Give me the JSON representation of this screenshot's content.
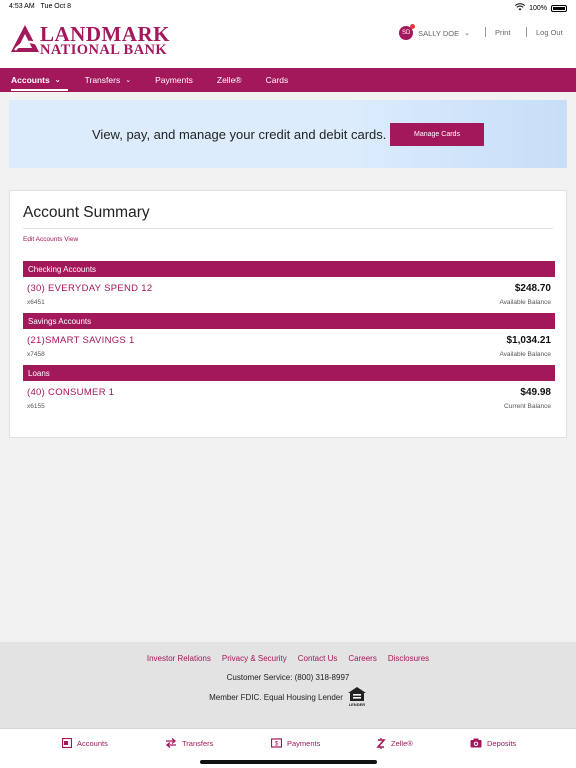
{
  "status_bar": {
    "time": "4:53 AM",
    "date": "Tue Oct 8",
    "battery": "100%"
  },
  "bank": {
    "name_line1": "LANDMARK",
    "name_line2": "NATIONAL BANK",
    "brand_color": "#a3175b"
  },
  "header": {
    "avatar_initials": "SD",
    "user_name": "SALLY DOE",
    "print_label": "Print",
    "logout_label": "Log Out"
  },
  "nav": {
    "items": [
      {
        "label": "Accounts",
        "has_menu": true,
        "active": true
      },
      {
        "label": "Transfers",
        "has_menu": true
      },
      {
        "label": "Payments"
      },
      {
        "label": "Zelle®"
      },
      {
        "label": "Cards"
      }
    ]
  },
  "banner": {
    "text": "View, pay, and manage your credit and debit cards.",
    "button_label": "Manage Cards"
  },
  "summary": {
    "title": "Account Summary",
    "edit_link": "Edit Accounts View",
    "groups": [
      {
        "heading": "Checking Accounts",
        "account": {
          "name": "(30) EVERYDAY SPEND 12",
          "number": "x6451",
          "balance": "$248.70",
          "balance_label": "Available Balance"
        }
      },
      {
        "heading": "Savings Accounts",
        "account": {
          "name": "(21)SMART SAVINGS 1",
          "number": "x7458",
          "balance": "$1,034.21",
          "balance_label": "Available Balance"
        }
      },
      {
        "heading": "Loans",
        "account": {
          "name": "(40) CONSUMER 1",
          "number": "x6155",
          "balance": "$49.98",
          "balance_label": "Current Balance"
        }
      }
    ]
  },
  "footer": {
    "links": [
      "Investor Relations",
      "Privacy & Security",
      "Contact Us",
      "Careers",
      "Disclosures"
    ],
    "customer_service": "Customer Service: (800) 318-8997",
    "fdic": "Member FDIC. Equal Housing Lender",
    "ehl_text": "LENDER"
  },
  "tabbar": {
    "items": [
      {
        "label": "Accounts",
        "icon": "accounts-icon"
      },
      {
        "label": "Transfers",
        "icon": "transfer-arrows-icon"
      },
      {
        "label": "Payments",
        "icon": "payments-icon"
      },
      {
        "label": "Zelle®",
        "icon": "zelle-icon"
      },
      {
        "label": "Deposits",
        "icon": "camera-icon"
      }
    ]
  }
}
